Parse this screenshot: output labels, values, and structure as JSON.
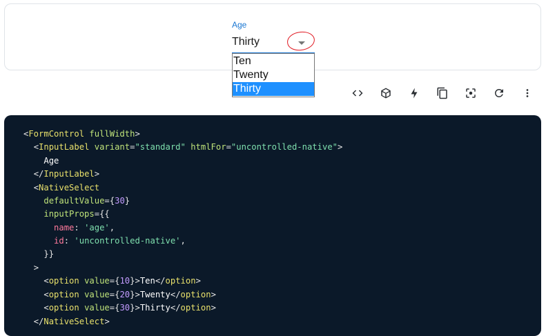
{
  "demo": {
    "label": "Age",
    "selected_value": "Thirty",
    "options": [
      "Ten",
      "Twenty",
      "Thirty"
    ],
    "selected_index": 2,
    "accent_color": "#1976d2",
    "highlight_color": "#1e90ff",
    "annotation_color": "#e0161f"
  },
  "toolbar": {
    "icons": [
      "code-icon",
      "codesandbox-icon",
      "stackblitz-icon",
      "copy-icon",
      "focus-icon",
      "reset-icon",
      "more-vert-icon"
    ]
  },
  "code": {
    "background": "#0b1929",
    "lines": [
      "<FormControl fullWidth>",
      "  <InputLabel variant=\"standard\" htmlFor=\"uncontrolled-native\">",
      "    Age",
      "  </InputLabel>",
      "  <NativeSelect",
      "    defaultValue={30}",
      "    inputProps={{",
      "      name: 'age',",
      "      id: 'uncontrolled-native',",
      "    }}",
      "  >",
      "    <option value={10}>Ten</option>",
      "    <option value={20}>Twenty</option>",
      "    <option value={30}>Thirty</option>",
      "  </NativeSelect>"
    ]
  }
}
